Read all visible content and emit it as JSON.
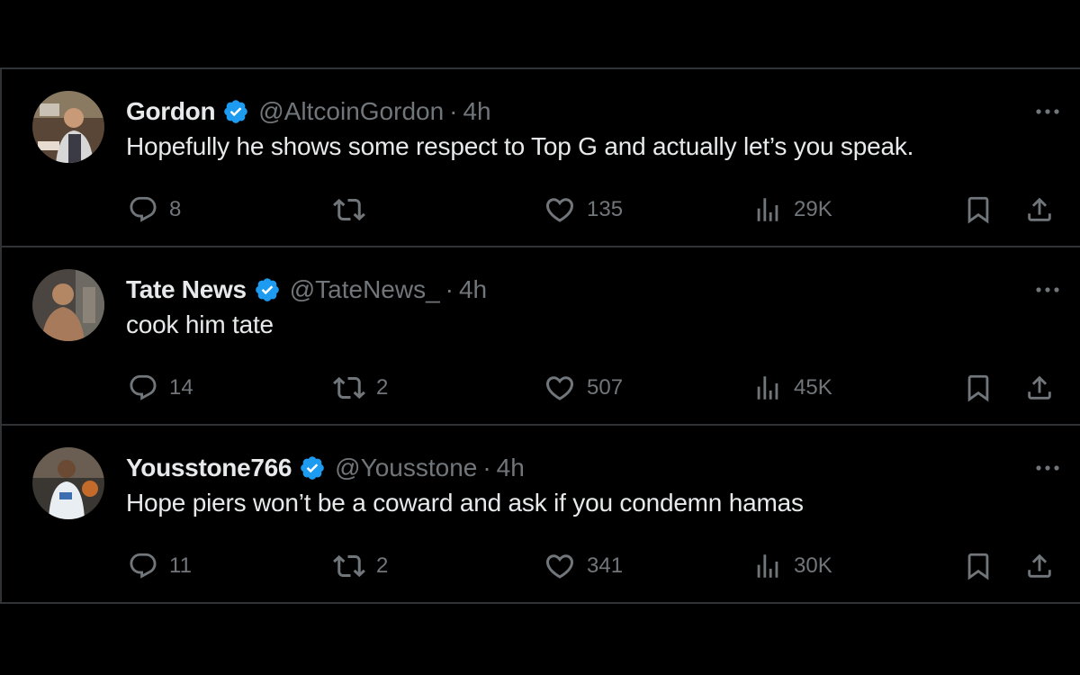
{
  "tweets": [
    {
      "name": "Gordon",
      "handle": "@AltcoinGordon",
      "separator": "·",
      "time": "4h",
      "text": "Hopefully he shows some respect to Top G and actually let’s you speak.",
      "replies": "8",
      "retweets": "",
      "likes": "135",
      "views": "29K"
    },
    {
      "name": "Tate News",
      "handle": "@TateNews_",
      "separator": "·",
      "time": "4h",
      "text": "cook him tate",
      "replies": "14",
      "retweets": "2",
      "likes": "507",
      "views": "45K"
    },
    {
      "name": "Yousstone766",
      "handle": "@Yousstone",
      "separator": "·",
      "time": "4h",
      "text": "Hope piers won’t be a coward and ask if you condemn hamas",
      "replies": "11",
      "retweets": "2",
      "likes": "341",
      "views": "30K"
    }
  ],
  "colors": {
    "background": "#000000",
    "divider": "#2f3336",
    "text_primary": "#e7e9ea",
    "text_secondary": "#71767b",
    "verified": "#1d9bf0"
  },
  "icons": [
    "reply-icon",
    "retweet-icon",
    "like-icon",
    "views-icon",
    "bookmark-icon",
    "share-icon",
    "more-icon",
    "verified-badge-icon"
  ]
}
